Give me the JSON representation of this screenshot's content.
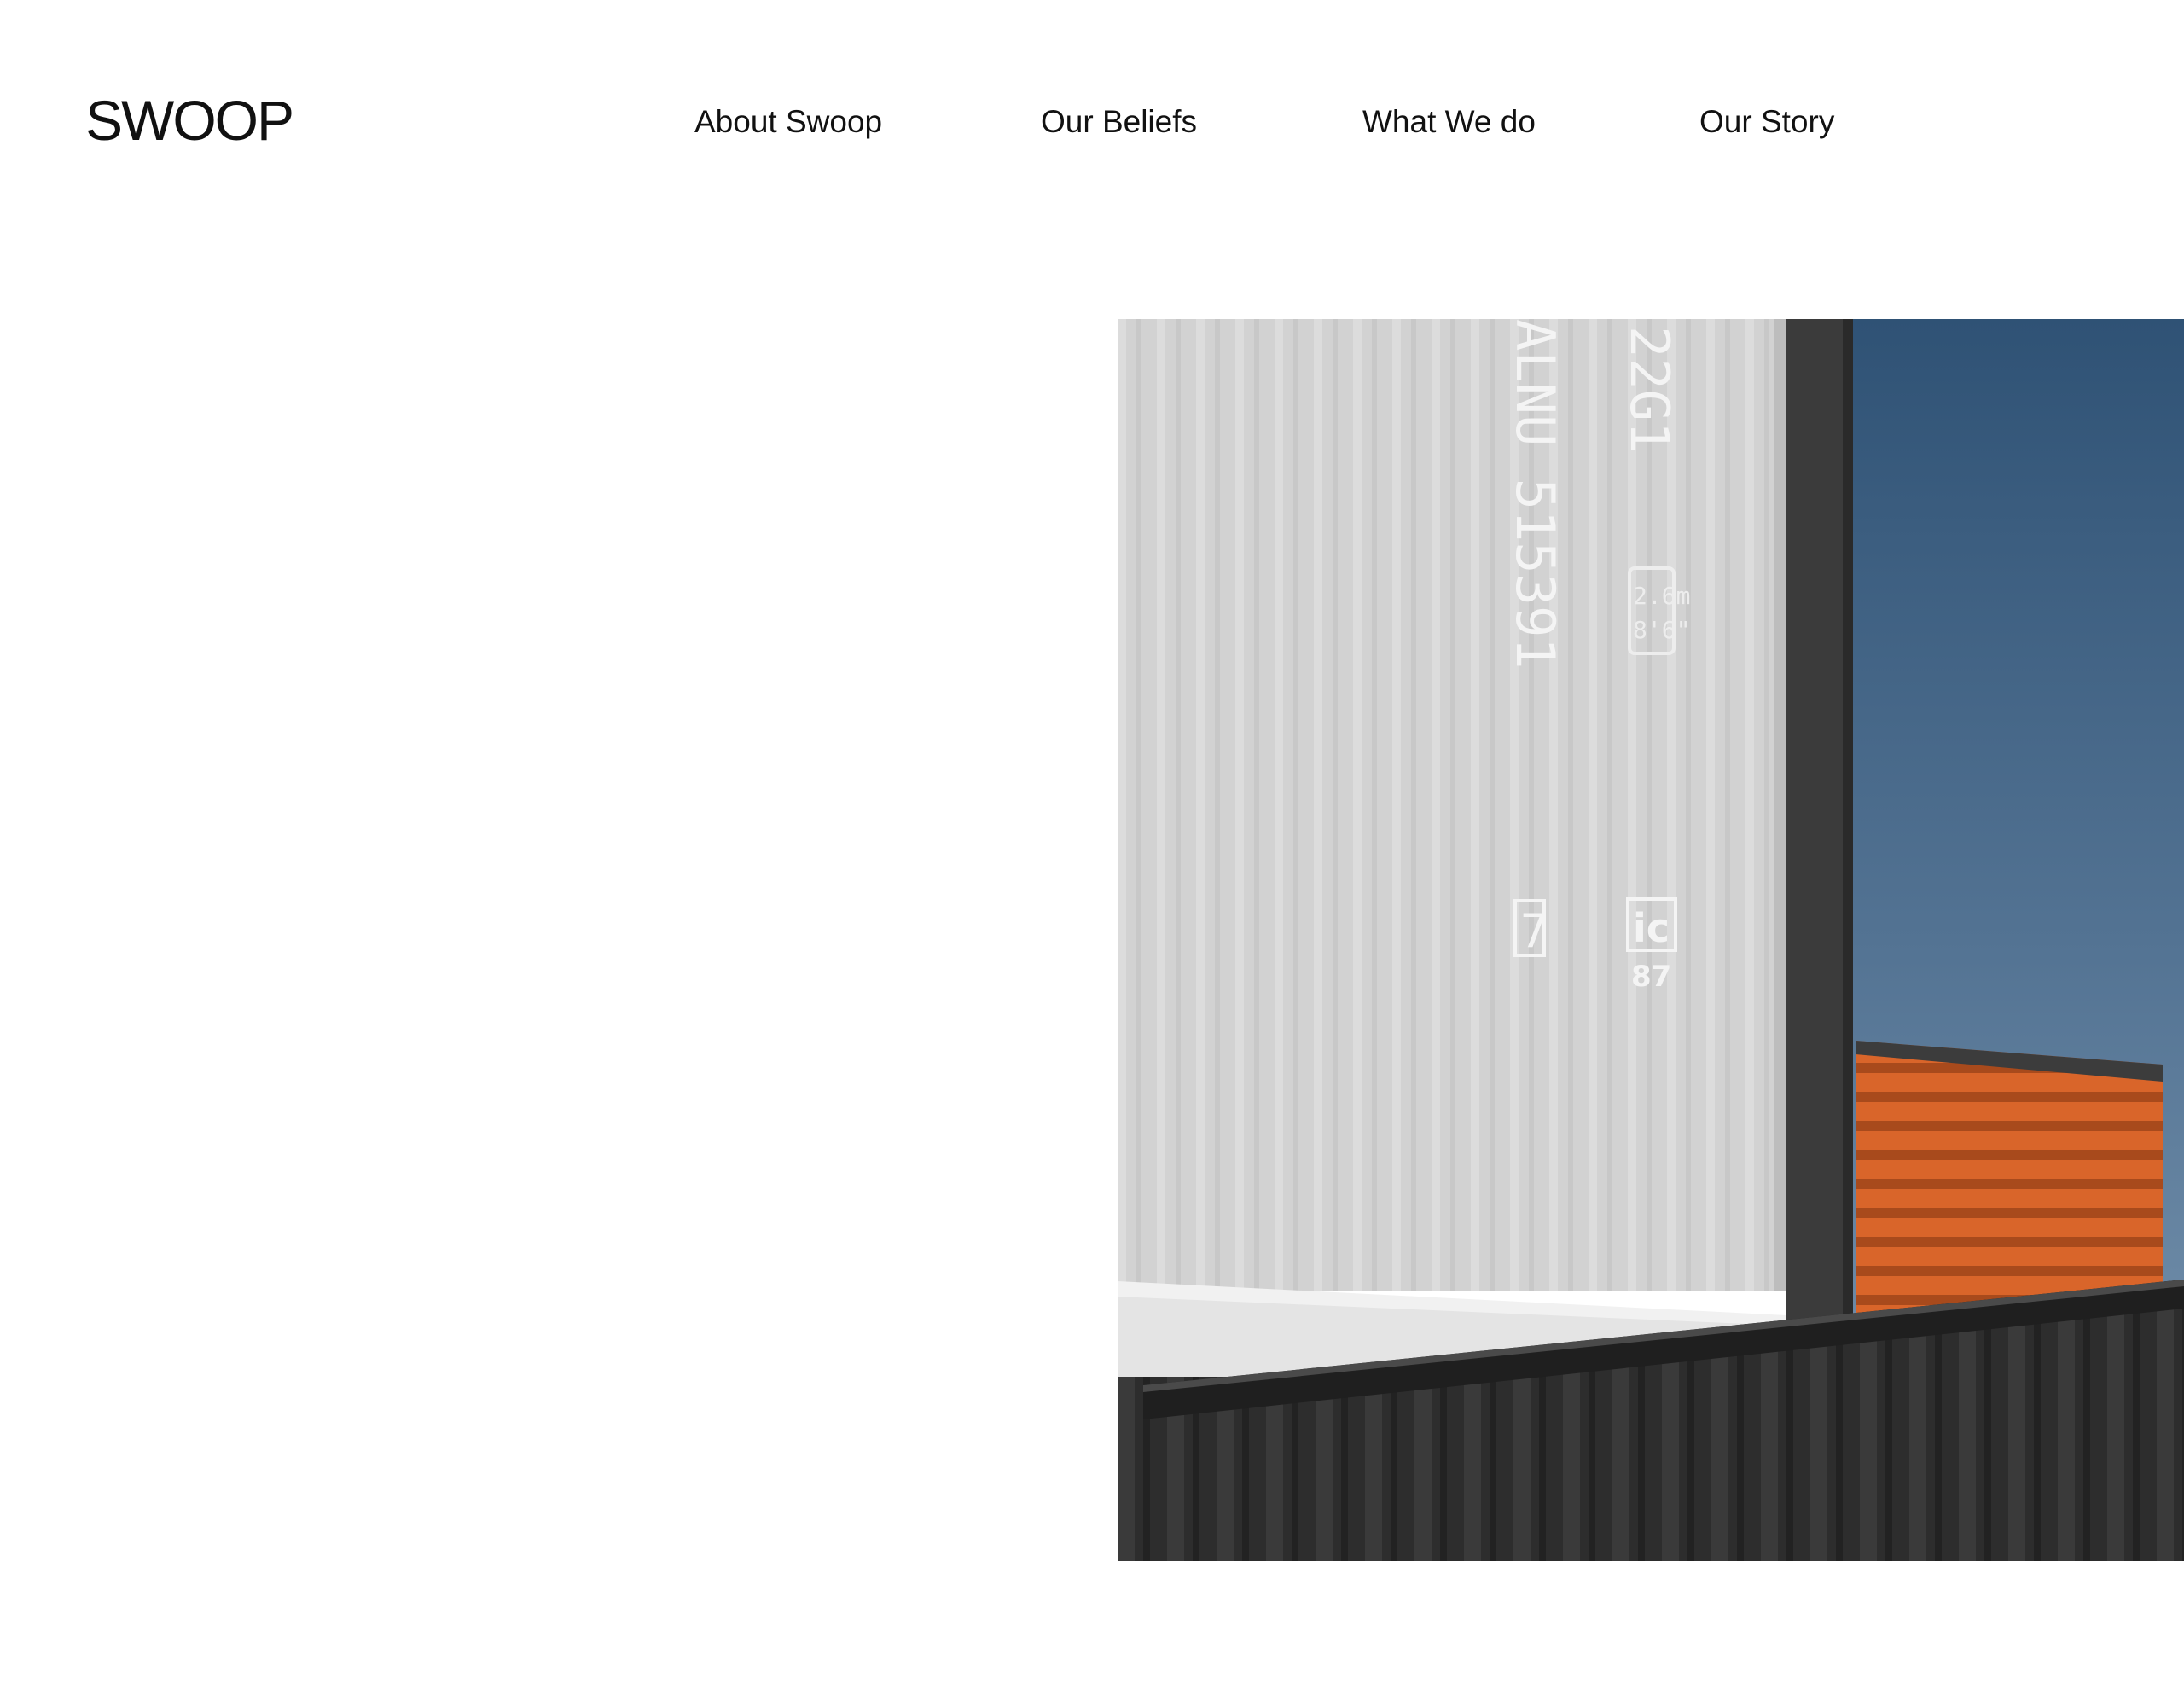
{
  "brand": {
    "logo_text": "SWOOP"
  },
  "nav": {
    "items": [
      {
        "label": "About Swoop"
      },
      {
        "label": "Our Beliefs"
      },
      {
        "label": "What We do"
      },
      {
        "label": "Our Story"
      }
    ]
  },
  "hero_image": {
    "subject": "shipping-containers-photo",
    "container_code": "ALNU 515391",
    "check_digit": "7",
    "type_code": "22G1",
    "height_label_1": "2.6m",
    "height_label_2": "8'6\"",
    "ic_mark": "ic",
    "ic_year": "87",
    "colors": {
      "sky": "#48688a",
      "orange": "#d9652a",
      "dark": "#2a2a2a",
      "light": "#d4d4d4"
    }
  }
}
